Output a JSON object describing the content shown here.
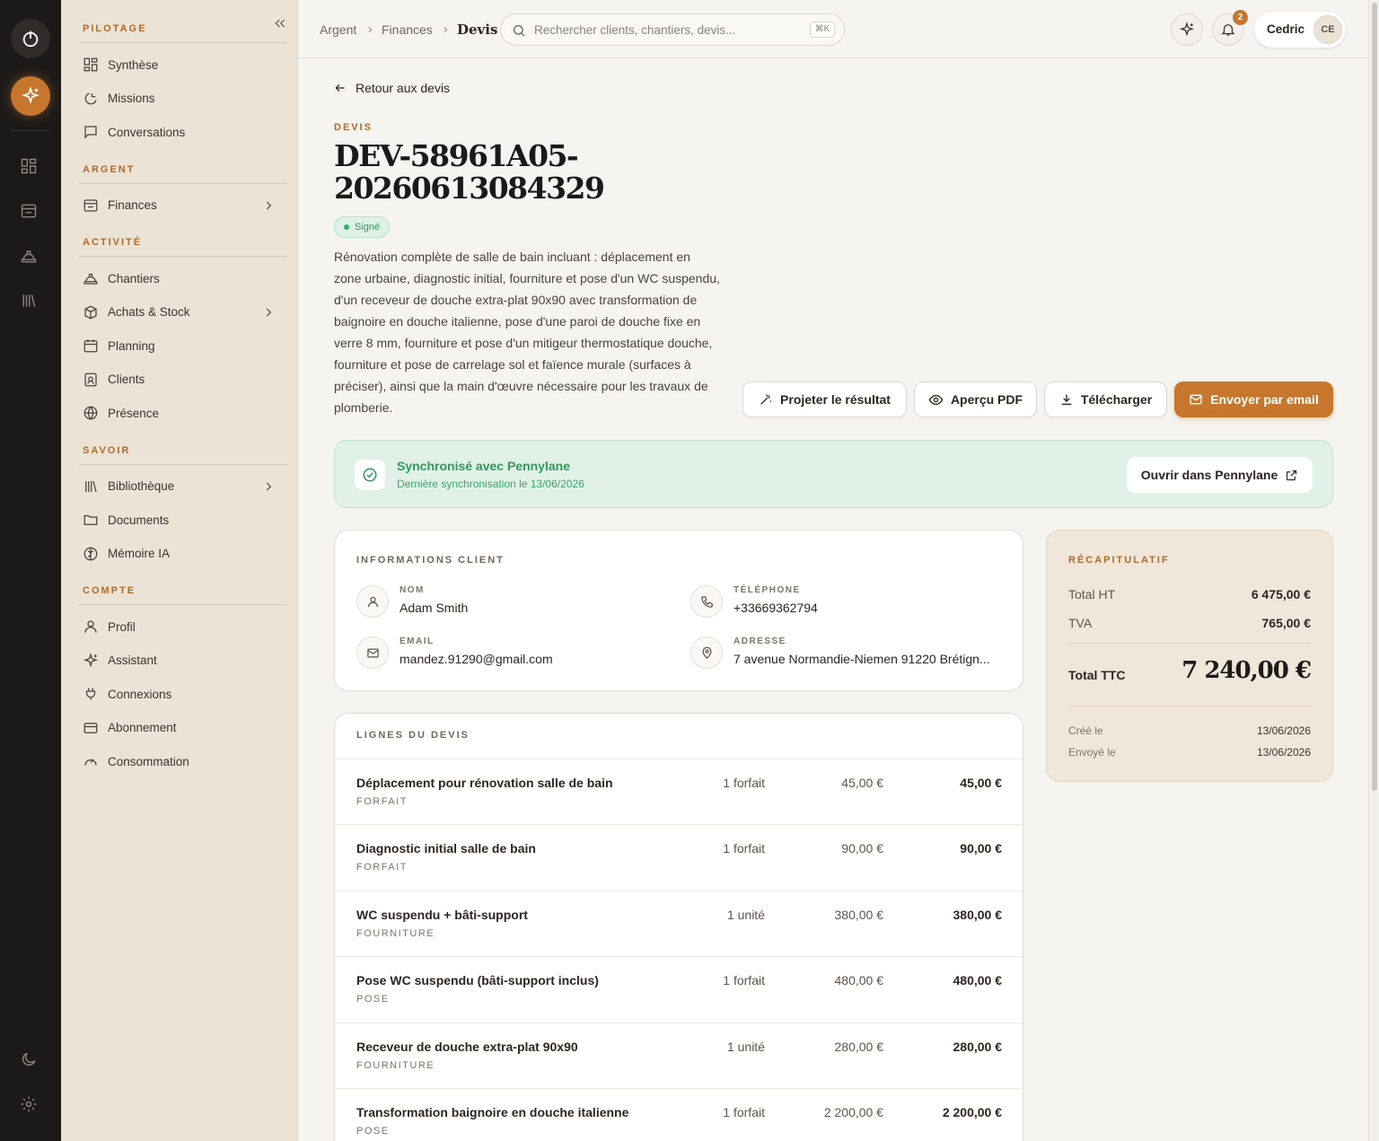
{
  "sidebar": {
    "sections": [
      {
        "title": "PILOTAGE",
        "items": [
          {
            "label": "Synthèse",
            "icon": "dashboard-icon"
          },
          {
            "label": "Missions",
            "icon": "moon-clock-icon"
          },
          {
            "label": "Conversations",
            "icon": "chat-icon"
          }
        ]
      },
      {
        "title": "ARGENT",
        "items": [
          {
            "label": "Finances",
            "icon": "wallet-icon",
            "chevron": true
          }
        ]
      },
      {
        "title": "ACTIVITÉ",
        "items": [
          {
            "label": "Chantiers",
            "icon": "hardhat-icon"
          },
          {
            "label": "Achats & Stock",
            "icon": "box-icon",
            "chevron": true
          },
          {
            "label": "Planning",
            "icon": "calendar-icon"
          },
          {
            "label": "Clients",
            "icon": "contact-card-icon"
          },
          {
            "label": "Présence",
            "icon": "globe-icon"
          }
        ]
      },
      {
        "title": "SAVOIR",
        "items": [
          {
            "label": "Bibliothèque",
            "icon": "library-icon",
            "chevron": true
          },
          {
            "label": "Documents",
            "icon": "folder-icon"
          },
          {
            "label": "Mémoire IA",
            "icon": "brain-icon"
          }
        ]
      },
      {
        "title": "COMPTE",
        "items": [
          {
            "label": "Profil",
            "icon": "user-icon"
          },
          {
            "label": "Assistant",
            "icon": "sparkles-icon"
          },
          {
            "label": "Connexions",
            "icon": "plug-icon"
          },
          {
            "label": "Abonnement",
            "icon": "credit-card-icon"
          },
          {
            "label": "Consommation",
            "icon": "gauge-icon"
          }
        ]
      }
    ]
  },
  "topbar": {
    "breadcrumb": [
      "Argent",
      "Finances",
      "Devis"
    ],
    "search_placeholder": "Rechercher clients, chantiers, devis...",
    "search_shortcut": "⌘K",
    "notifications_count": "2",
    "user_name": "Cedric",
    "user_initials": "CE"
  },
  "main": {
    "back_label": "Retour aux devis",
    "eyebrow": "DEVIS",
    "title": "DEV-58961A05-20260613084329",
    "status": "Signé",
    "description": "Rénovation complète de salle de bain incluant : déplacement en zone urbaine, diagnostic initial, fourniture et pose d'un WC suspendu, d'un receveur de douche extra-plat 90x90 avec transformation de baignoire en douche italienne, pose d'une paroi de douche fixe en verre 8 mm, fourniture et pose d'un mitigeur thermostatique douche, fourniture et pose de carrelage sol et faïence murale (surfaces à préciser), ainsi que la main d'œuvre nécessaire pour les travaux de plomberie.",
    "actions": {
      "project": "Projeter le résultat",
      "preview": "Aperçu PDF",
      "download": "Télécharger",
      "send": "Envoyer par email"
    }
  },
  "sync": {
    "title": "Synchronisé avec Pennylane",
    "subtitle": "Dernière synchronisation le 13/06/2026",
    "open_label": "Ouvrir dans Pennylane"
  },
  "client": {
    "title": "INFORMATIONS CLIENT",
    "name_label": "NOM",
    "name": "Adam Smith",
    "phone_label": "TÉLÉPHONE",
    "phone": "+33669362794",
    "email_label": "EMAIL",
    "email": "mandez.91290@gmail.com",
    "address_label": "ADRESSE",
    "address": "7 avenue Normandie-Niemen 91220 Brétign..."
  },
  "lines": {
    "title": "LIGNES DU DEVIS",
    "items": [
      {
        "name": "Déplacement pour rénovation salle de bain",
        "category": "FORFAIT",
        "qty": "1 forfait",
        "unit": "45,00 €",
        "total": "45,00 €"
      },
      {
        "name": "Diagnostic initial salle de bain",
        "category": "FORFAIT",
        "qty": "1 forfait",
        "unit": "90,00 €",
        "total": "90,00 €"
      },
      {
        "name": "WC suspendu + bâti-support",
        "category": "FOURNITURE",
        "qty": "1 unité",
        "unit": "380,00 €",
        "total": "380,00 €"
      },
      {
        "name": "Pose WC suspendu (bâti-support inclus)",
        "category": "POSE",
        "qty": "1 forfait",
        "unit": "480,00 €",
        "total": "480,00 €"
      },
      {
        "name": "Receveur de douche extra-plat 90x90",
        "category": "FOURNITURE",
        "qty": "1 unité",
        "unit": "280,00 €",
        "total": "280,00 €"
      },
      {
        "name": "Transformation baignoire en douche italienne",
        "category": "POSE",
        "qty": "1 forfait",
        "unit": "2 200,00 €",
        "total": "2 200,00 €"
      }
    ]
  },
  "recap": {
    "title": "RÉCAPITULATIF",
    "ht_label": "Total HT",
    "ht": "6 475,00 €",
    "tva_label": "TVA",
    "tva": "765,00 €",
    "ttc_label": "Total TTC",
    "ttc": "7 240,00 €",
    "created_label": "Créé le",
    "created": "13/06/2026",
    "sent_label": "Envoyé le",
    "sent": "13/06/2026"
  },
  "colors": {
    "accent": "#c7772d",
    "success": "#2e9a5a",
    "rail": "#1c1a18",
    "sidebar": "#ebe3d6"
  }
}
